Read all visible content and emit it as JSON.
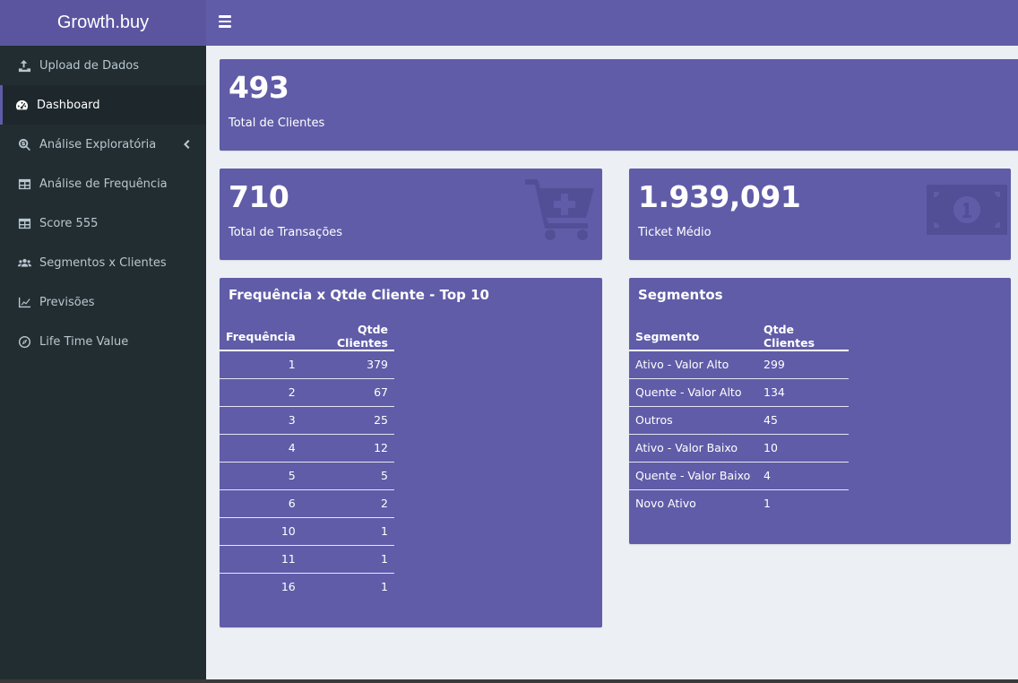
{
  "brand": "Growth.buy",
  "sidebar": {
    "items": [
      {
        "label": "Upload de Dados",
        "icon": "upload-icon"
      },
      {
        "label": "Dashboard",
        "icon": "tachometer-icon"
      },
      {
        "label": "Análise Exploratória",
        "icon": "search-dollar-icon"
      },
      {
        "label": "Análise de Frequência",
        "icon": "table-icon"
      },
      {
        "label": "Score 555",
        "icon": "table-icon"
      },
      {
        "label": "Segmentos x Clientes",
        "icon": "users-icon"
      },
      {
        "label": "Previsões",
        "icon": "line-chart-icon"
      },
      {
        "label": "Life Time Value",
        "icon": "compass-icon"
      }
    ],
    "active_index": 1
  },
  "kpis": {
    "total_clientes": {
      "value": "493",
      "label": "Total de Clientes"
    },
    "total_transacoes": {
      "value": "710",
      "label": "Total de Transações",
      "icon": "cart-plus-icon"
    },
    "ticket_medio": {
      "value": "1.939,091",
      "label": "Ticket Médio",
      "icon": "money-bill-icon"
    }
  },
  "freq_table": {
    "title": "Frequência x Qtde Cliente - Top 10",
    "headers": [
      "Frequência",
      "Qtde Clientes"
    ],
    "rows": [
      [
        "1",
        "379"
      ],
      [
        "2",
        "67"
      ],
      [
        "3",
        "25"
      ],
      [
        "4",
        "12"
      ],
      [
        "5",
        "5"
      ],
      [
        "6",
        "2"
      ],
      [
        "10",
        "1"
      ],
      [
        "11",
        "1"
      ],
      [
        "16",
        "1"
      ]
    ]
  },
  "seg_table": {
    "title": "Segmentos",
    "headers": [
      "Segmento",
      "Qtde Clientes"
    ],
    "rows": [
      [
        "Ativo - Valor Alto",
        "299"
      ],
      [
        "Quente - Valor Alto",
        "134"
      ],
      [
        "Outros",
        "45"
      ],
      [
        "Ativo - Valor Baixo",
        "10"
      ],
      [
        "Quente - Valor Baixo",
        "4"
      ],
      [
        "Novo Ativo",
        "1"
      ]
    ]
  },
  "colors": {
    "accent": "#605ca8",
    "sidebar": "#222d32",
    "background": "#ecf0f5"
  }
}
